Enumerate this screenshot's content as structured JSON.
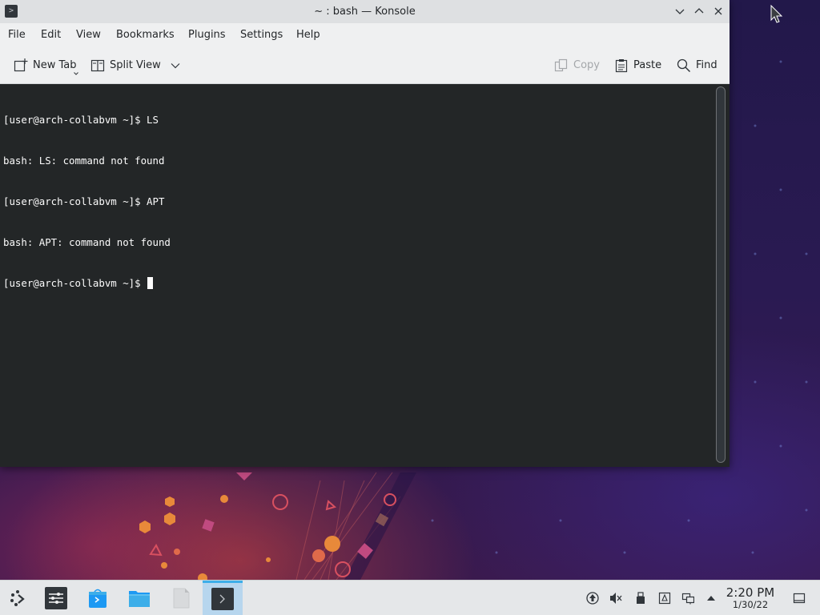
{
  "window": {
    "title": "~ : bash — Konsole"
  },
  "menu": [
    "File",
    "Edit",
    "View",
    "Bookmarks",
    "Plugins",
    "Settings",
    "Help"
  ],
  "toolbar": {
    "new_tab": "New Tab",
    "split_view": "Split View",
    "copy": "Copy",
    "paste": "Paste",
    "find": "Find"
  },
  "terminal": {
    "lines": [
      "[user@arch-collabvm ~]$ LS",
      "bash: LS: command not found",
      "[user@arch-collabvm ~]$ APT",
      "bash: APT: command not found"
    ],
    "prompt": "[user@arch-collabvm ~]$ ",
    "background": "#232627",
    "foreground": "#fcfcfc"
  },
  "taskbar": {
    "apps": [
      {
        "name": "application-launcher",
        "icon": "kde-launcher-icon",
        "active": false
      },
      {
        "name": "system-settings",
        "icon": "settings-sliders-icon",
        "active": false
      },
      {
        "name": "discover",
        "icon": "store-bag-icon",
        "active": false
      },
      {
        "name": "dolphin",
        "icon": "folder-icon",
        "active": false
      },
      {
        "name": "kate",
        "icon": "document-icon",
        "active": false
      },
      {
        "name": "konsole",
        "icon": "terminal-icon",
        "active": true
      }
    ],
    "tray": [
      "updates-icon",
      "volume-muted-icon",
      "usb-device-icon",
      "clipboard-icon",
      "network-icon",
      "expand-tray-icon"
    ],
    "time": "2:20 PM",
    "date": "1/30/22",
    "accent": "#3daee9"
  }
}
